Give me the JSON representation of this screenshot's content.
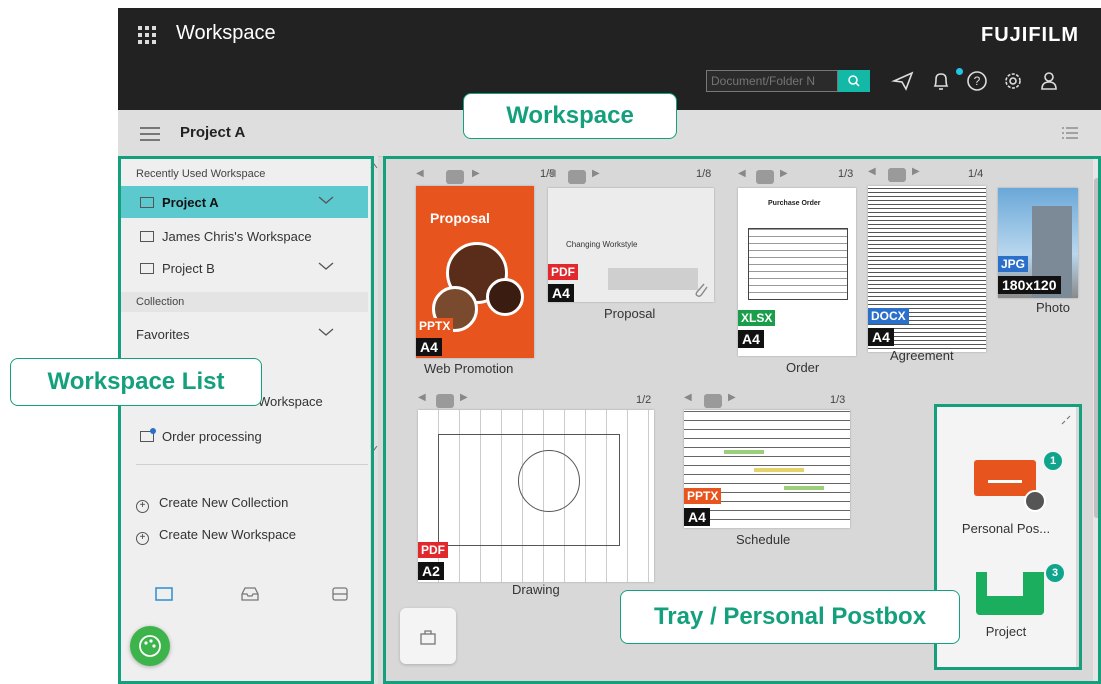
{
  "header": {
    "app_title": "Workspace",
    "brand": "FUJIFILM",
    "search_placeholder": "Document/Folder N"
  },
  "subheader": {
    "title": "Project A"
  },
  "sidebar": {
    "recent_heading": "Recently Used Workspace",
    "items": [
      {
        "label": "Project A"
      },
      {
        "label": "James Chris's Workspace"
      },
      {
        "label": "Project B"
      }
    ],
    "collection_heading": "Collection",
    "favorites": "Favorites",
    "workspace_partial": "Workspace",
    "order_processing": "Order processing",
    "create_collection": "Create New Collection",
    "create_workspace": "Create New Workspace"
  },
  "documents": [
    {
      "name": "Web Promotion",
      "page": "1/5",
      "type": "PPTX",
      "size": "A4",
      "type_color": "#e8541e"
    },
    {
      "name": "Proposal",
      "page": "1/8",
      "type": "PDF",
      "size": "A4",
      "type_color": "#e0282d"
    },
    {
      "name": "Order",
      "page": "1/3",
      "type": "XLSX",
      "size": "A4",
      "type_color": "#1b9e4b"
    },
    {
      "name": "Agreement",
      "page": "1/4",
      "type": "DOCX",
      "size": "A4",
      "type_color": "#2a6fc9"
    },
    {
      "name": "Photo",
      "page": "",
      "type": "JPG",
      "size": "180x120",
      "type_color": "#2a6fc9"
    },
    {
      "name": "Drawing",
      "page": "1/2",
      "type": "PDF",
      "size": "A2",
      "type_color": "#e0282d"
    },
    {
      "name": "Schedule",
      "page": "1/3",
      "type": "PPTX",
      "size": "A4",
      "type_color": "#e8541e"
    }
  ],
  "thumb_text": {
    "promo": "Proposal",
    "proposal": "Changing Workstyle",
    "order": "Purchase Order"
  },
  "tray": [
    {
      "label": "Personal Pos...",
      "count": "1"
    },
    {
      "label": "Project",
      "count": "3"
    }
  ],
  "callouts": {
    "workspace": "Workspace",
    "workspace_list": "Workspace List",
    "tray": "Tray / Personal Postbox"
  },
  "colors": {
    "accent": "#14a07d",
    "active_item": "#5cc9cf",
    "topbar": "#222222"
  }
}
